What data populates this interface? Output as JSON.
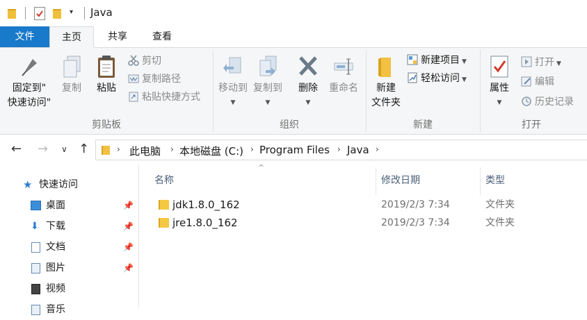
{
  "window": {
    "title": "Java"
  },
  "tabs": {
    "file": "文件",
    "home": "主页",
    "share": "共享",
    "view": "查看"
  },
  "ribbon": {
    "clipboard": {
      "pin_label_line1": "固定到\"",
      "pin_label_line2": "快速访问\"",
      "copy_label": "复制",
      "paste_label": "粘贴",
      "cut_label": "剪切",
      "copy_path_label": "复制路径",
      "paste_shortcut_label": "粘贴快捷方式",
      "group_label": "剪贴板"
    },
    "organize": {
      "move_to_label": "移动到",
      "copy_to_label": "复制到",
      "delete_label": "删除",
      "rename_label": "重命名",
      "group_label": "组织"
    },
    "new": {
      "new_folder_line1": "新建",
      "new_folder_line2": "文件夹",
      "new_item_label": "新建项目",
      "easy_access_label": "轻松访问",
      "group_label": "新建"
    },
    "open": {
      "properties_label": "属性",
      "open_label": "打开",
      "edit_label": "编辑",
      "history_label": "历史记录",
      "group_label": "打开"
    }
  },
  "address": {
    "crumbs": [
      "此电脑",
      "本地磁盘 (C:)",
      "Program Files",
      "Java"
    ]
  },
  "nav": {
    "quick_access": "快速访问",
    "items": [
      "桌面",
      "下载",
      "文档",
      "图片",
      "视频",
      "音乐"
    ]
  },
  "filelist": {
    "headers": {
      "name": "名称",
      "date": "修改日期",
      "type": "类型"
    },
    "rows": [
      {
        "name": "jdk1.8.0_162",
        "date": "2019/2/3 7:34",
        "type": "文件夹"
      },
      {
        "name": "jre1.8.0_162",
        "date": "2019/2/3 7:34",
        "type": "文件夹"
      }
    ]
  }
}
